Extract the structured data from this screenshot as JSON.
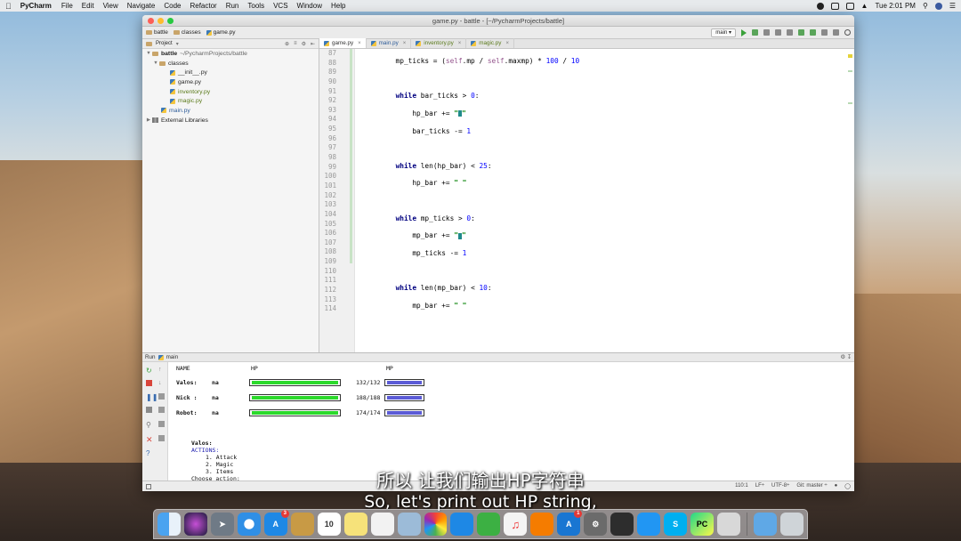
{
  "menubar": {
    "app_name": "PyCharm",
    "items": [
      "File",
      "Edit",
      "View",
      "Navigate",
      "Code",
      "Refactor",
      "Run",
      "Tools",
      "VCS",
      "Window",
      "Help"
    ],
    "clock": "Tue 2:01 PM"
  },
  "window": {
    "title": "game.py - battle - [~/PycharmProjects/battle]"
  },
  "breadcrumbs": [
    "battle",
    "classes",
    "game.py"
  ],
  "toolbar": {
    "run_config": "main"
  },
  "project_panel": {
    "header": "Project",
    "tree": [
      {
        "name": "battle",
        "path": "~/PycharmProjects/battle",
        "type": "folder",
        "level": 0,
        "expanded": true
      },
      {
        "name": "classes",
        "path": "",
        "type": "folder",
        "level": 1,
        "expanded": true
      },
      {
        "name": "__init__.py",
        "path": "",
        "type": "py",
        "level": 2
      },
      {
        "name": "game.py",
        "path": "",
        "type": "py",
        "level": 2
      },
      {
        "name": "inventory.py",
        "path": "",
        "type": "py",
        "level": 2
      },
      {
        "name": "magic.py",
        "path": "",
        "type": "py",
        "level": 2
      },
      {
        "name": "main.py",
        "path": "",
        "type": "py",
        "level": 1
      },
      {
        "name": "External Libraries",
        "path": "",
        "type": "lib",
        "level": 0,
        "expanded": false
      }
    ]
  },
  "tabs": [
    {
      "label": "game.py",
      "active": true
    },
    {
      "label": "main.py",
      "active": false
    },
    {
      "label": "inventory.py",
      "active": false
    },
    {
      "label": "magic.py",
      "active": false
    }
  ],
  "editor": {
    "line_numbers": [
      "87",
      "88",
      "89",
      "90",
      "91",
      "92",
      "93",
      "94",
      "95",
      "96",
      "97",
      "98",
      "99",
      "100",
      "101",
      "102",
      "103",
      "104",
      "105",
      "106",
      "107",
      "108",
      "109",
      "110",
      "111",
      "112",
      "113",
      "114"
    ],
    "current_line": "110"
  },
  "run_panel": {
    "label": "Run",
    "config": "main",
    "header_name": "NAME",
    "header_hp": "HP",
    "header_mp": "MP",
    "players": [
      {
        "name": "Valos:",
        "tag": "na",
        "hp_text": "132/132",
        "hp_fraction": 1.0,
        "mp_fraction": 1.0
      },
      {
        "name": "Nick :",
        "tag": "na",
        "hp_text": "188/188",
        "hp_fraction": 1.0,
        "mp_fraction": 1.0
      },
      {
        "name": "Robot:",
        "tag": "na",
        "hp_text": "174/174",
        "hp_fraction": 1.0,
        "mp_fraction": 1.0
      }
    ],
    "menu_player": "Valos:",
    "actions_label": "ACTIONS:",
    "actions": [
      "1. Attack",
      "2. Magic",
      "3. Items"
    ],
    "prompt": "Choose action:"
  },
  "statusbar": {
    "position": "110:1",
    "line_sep": "LF÷",
    "encoding": "UTF-8÷",
    "git": "Git: master ÷"
  },
  "subtitles": {
    "chinese": "所以 让我们输出HP字符串",
    "english": "So, let's print out HP string,"
  },
  "dock": {
    "apps": [
      "finder-icon",
      "siri-icon",
      "launchpad-icon",
      "safari-icon",
      "app-store-blue-icon",
      "notes-icon",
      "calendar-icon",
      "stickies-icon",
      "reminders-icon",
      "preview-icon",
      "photos-icon",
      "messages-blue-icon",
      "facetime-icon",
      "itunes-icon",
      "ibooks-icon",
      "app-store-icon",
      "system-preferences-icon",
      "quicktime-icon",
      "messages-icon",
      "skype-icon",
      "pycharm-icon",
      "notes-stack-icon",
      "downloads-folder-icon",
      "trash-icon"
    ],
    "calendar_day": "10",
    "badge_a": "3",
    "badge_b": "1"
  },
  "colors": {
    "hp_bar": "#2bd92b",
    "mp_bar": "#5b5bd6",
    "keyword": "#000080",
    "string": "#008000",
    "self_kw": "#94558d"
  }
}
